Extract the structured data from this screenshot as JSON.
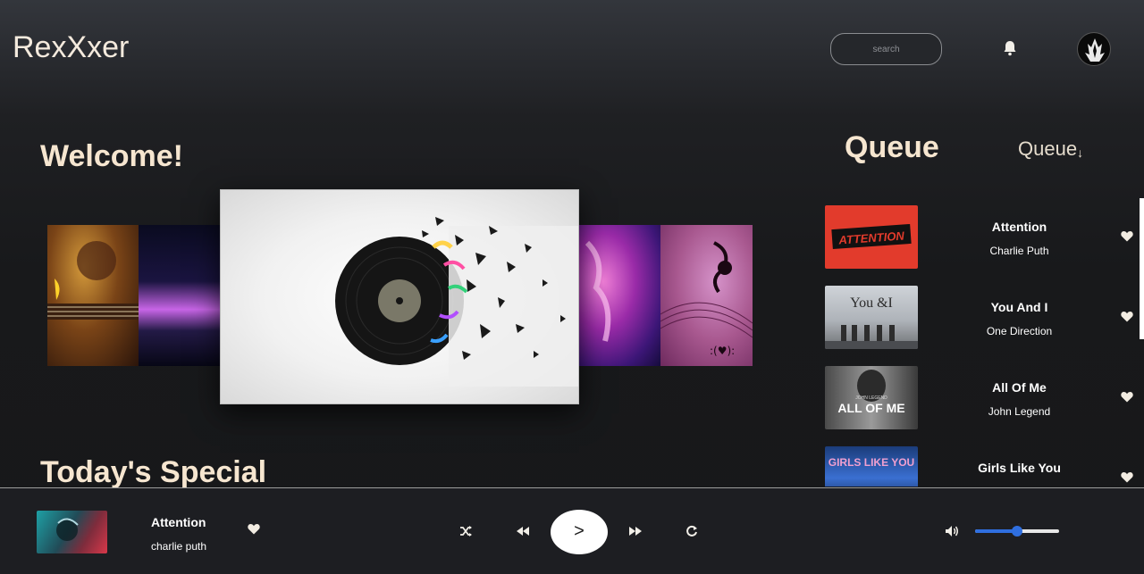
{
  "app": {
    "title": "RexXxer"
  },
  "header": {
    "search_placeholder": "search",
    "bell_icon": "bell-icon",
    "avatar_icon": "avatar"
  },
  "main": {
    "welcome": "Welcome!",
    "special": "Today's Special"
  },
  "queue": {
    "title": "Queue",
    "dropdown_label": "Queue",
    "dropdown_arrow": "↓",
    "items": [
      {
        "title": "Attention",
        "artist": "Charlie Puth",
        "thumb_text": "ATTENTION"
      },
      {
        "title": "You And I",
        "artist": "One Direction",
        "thumb_text": "You &I"
      },
      {
        "title": "All Of Me",
        "artist": "John Legend",
        "thumb_text": "ALL OF ME",
        "thumb_small": "JOHN LEGEND"
      },
      {
        "title": "Girls Like You",
        "artist": "",
        "thumb_text": "GIRLS LIKE YOU"
      }
    ]
  },
  "player": {
    "title": "Attention",
    "artist": "charlie puth",
    "play_label": ">",
    "volume": 0.5,
    "accent": "#2f6fe0"
  }
}
